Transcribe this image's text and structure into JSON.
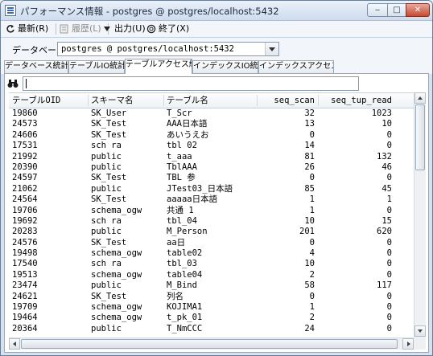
{
  "window": {
    "title": "パフォーマンス情報 - postgres @ postgres/localhost:5432",
    "min_glyph": "‒",
    "max_glyph": "□",
    "close_glyph": "✕"
  },
  "menu": {
    "refresh": "最新(R)",
    "history": "履歴(L)",
    "output": "出力(U)",
    "exit": "終了(X)"
  },
  "database": {
    "label": "データベース",
    "selected": "postgres @ postgres/localhost:5432"
  },
  "tabs": [
    {
      "label": "データベース統計"
    },
    {
      "label": "テーブルIO統計"
    },
    {
      "label": "テーブルアクセス統計"
    },
    {
      "label": "インデックスIO統計"
    },
    {
      "label": "インデックスアクセス統計"
    }
  ],
  "active_tab": "テーブルアクセス統計",
  "search": {
    "value": "",
    "placeholder": ""
  },
  "table": {
    "columns": [
      "テーブルOID",
      "スキーマ名",
      "テーブル名",
      "seq_scan",
      "seq_tup_read"
    ],
    "rows": [
      [
        "19860",
        "SK_User",
        "T_Scr",
        "32",
        "1023"
      ],
      [
        "24573",
        "SK_Test",
        "AAA日本語",
        "13",
        "10"
      ],
      [
        "24606",
        "SK_Test",
        "あいうえお",
        "0",
        "0"
      ],
      [
        "17531",
        "sch ra",
        "tbl 02",
        "14",
        "0"
      ],
      [
        "21992",
        "public",
        "t_aaa",
        "81",
        "132"
      ],
      [
        "20390",
        "public",
        "TblAAA",
        "26",
        "46"
      ],
      [
        "24597",
        "SK_Test",
        "TBL 参",
        "0",
        "0"
      ],
      [
        "21062",
        "public",
        "JTest03_日本語",
        "85",
        "45"
      ],
      [
        "24564",
        "SK_Test",
        "aaaaa日本語",
        "1",
        "1"
      ],
      [
        "19706",
        "schema_ogw",
        "共通 1",
        "1",
        "0"
      ],
      [
        "19692",
        "sch ra",
        "tbl_04",
        "10",
        "15"
      ],
      [
        "20283",
        "public",
        "M_Person",
        "201",
        "620"
      ],
      [
        "24576",
        "SK_Test",
        "aa日",
        "0",
        "0"
      ],
      [
        "19498",
        "schema_ogw",
        "table02",
        "4",
        "0"
      ],
      [
        "17540",
        "sch ra",
        "tbl_03",
        "10",
        "0"
      ],
      [
        "19513",
        "schema_ogw",
        "table04",
        "2",
        "0"
      ],
      [
        "23474",
        "public",
        "M_Bind",
        "58",
        "117"
      ],
      [
        "24621",
        "SK_Test",
        "列名",
        "0",
        "0"
      ],
      [
        "19709",
        "schema_ogw",
        "KOJIMA1",
        "1",
        "0"
      ],
      [
        "19464",
        "schema_ogw",
        "t_pk_01",
        "2",
        "0"
      ],
      [
        "20364",
        "public",
        "T_NmCCC",
        "24",
        "0"
      ]
    ]
  },
  "colors": {
    "accent": "#3a6ab8",
    "close_button": "#c54a34"
  }
}
